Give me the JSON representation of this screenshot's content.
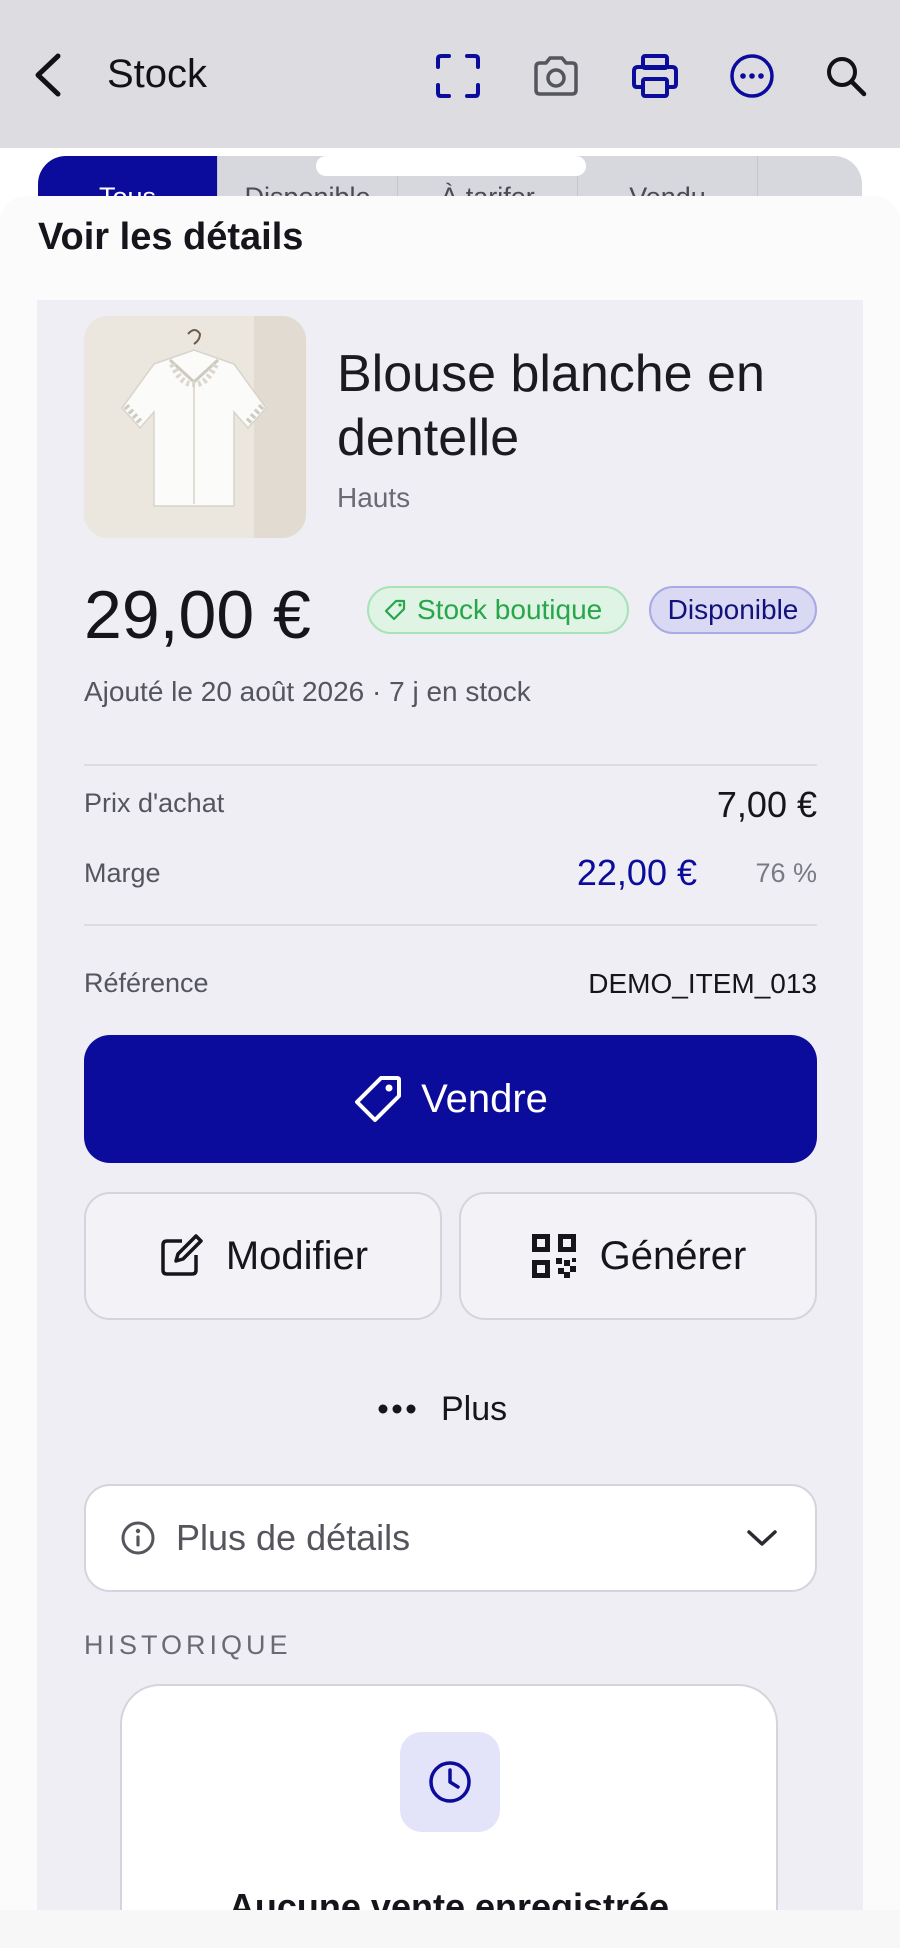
{
  "header": {
    "title": "Stock",
    "icons": [
      "back-chevron-icon",
      "scan-frame-icon",
      "camera-icon",
      "printer-icon",
      "more-circle-icon",
      "search-icon"
    ]
  },
  "tabs": [
    {
      "label": "Tous",
      "active": true
    },
    {
      "label": "Disponible",
      "active": false
    },
    {
      "label": "À tarifer",
      "active": false
    },
    {
      "label": "Vendu",
      "active": false
    }
  ],
  "sheet": {
    "title": "Voir les détails"
  },
  "product": {
    "name": "Blouse blanche en dentelle",
    "category": "Hauts",
    "price": "29,00 €",
    "badge_location": "Stock boutique",
    "badge_status": "Disponible",
    "added_info": "Ajouté le 20 août 2026 · 7 j en stock",
    "purchase_label": "Prix d'achat",
    "purchase_value": "7,00 €",
    "margin_label": "Marge",
    "margin_value": "22,00 €",
    "margin_percent": "76 %",
    "reference_label": "Référence",
    "reference_value": "DEMO_ITEM_013"
  },
  "actions": {
    "sell": "Vendre",
    "edit": "Modifier",
    "generate": "Générer",
    "more": "Plus"
  },
  "details": {
    "label": "Plus de détails"
  },
  "history": {
    "section_label": "HISTORIQUE",
    "empty_title": "Aucune vente enregistrée"
  },
  "colors": {
    "primary": "#0c0c9c",
    "success": "#27a64a",
    "background": "#eeeef4"
  }
}
